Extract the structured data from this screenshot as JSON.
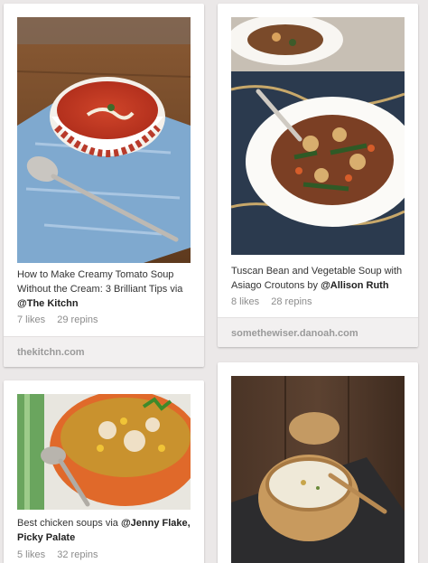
{
  "pins": [
    {
      "image_alt": "Creamy tomato soup in a red patterned bowl",
      "desc_prefix": "How to Make Creamy Tomato Soup Without the Cream: 3 Brilliant Tips via",
      "desc_user": "@The Kitchn",
      "likes": "7 likes",
      "repins": "29 repins",
      "source": "thekitchn.com"
    },
    {
      "image_alt": "Tuscan bean and vegetable soup with croutons",
      "desc_prefix": "Tuscan Bean and Vegetable Soup with Asiago Croutons by",
      "desc_user": "@Allison Ruth",
      "likes": "8 likes",
      "repins": "28 repins",
      "source": "somethewiser.danoah.com"
    },
    {
      "image_alt": "Chicken soup in an orange bowl",
      "desc_prefix": "Best chicken soups via",
      "desc_user": "@Jenny Flake, Picky Palate",
      "likes": "5 likes",
      "repins": "32 repins",
      "source": ""
    },
    {
      "image_alt": "Creamy soup in a bread bowl",
      "desc_prefix": "",
      "desc_user": "",
      "likes": "",
      "repins": "",
      "source": ""
    }
  ],
  "colors": {
    "background": "#ebe8e8",
    "card": "#ffffff",
    "source_bar": "#f2f0f0",
    "meta_text": "#8c8c8c"
  }
}
